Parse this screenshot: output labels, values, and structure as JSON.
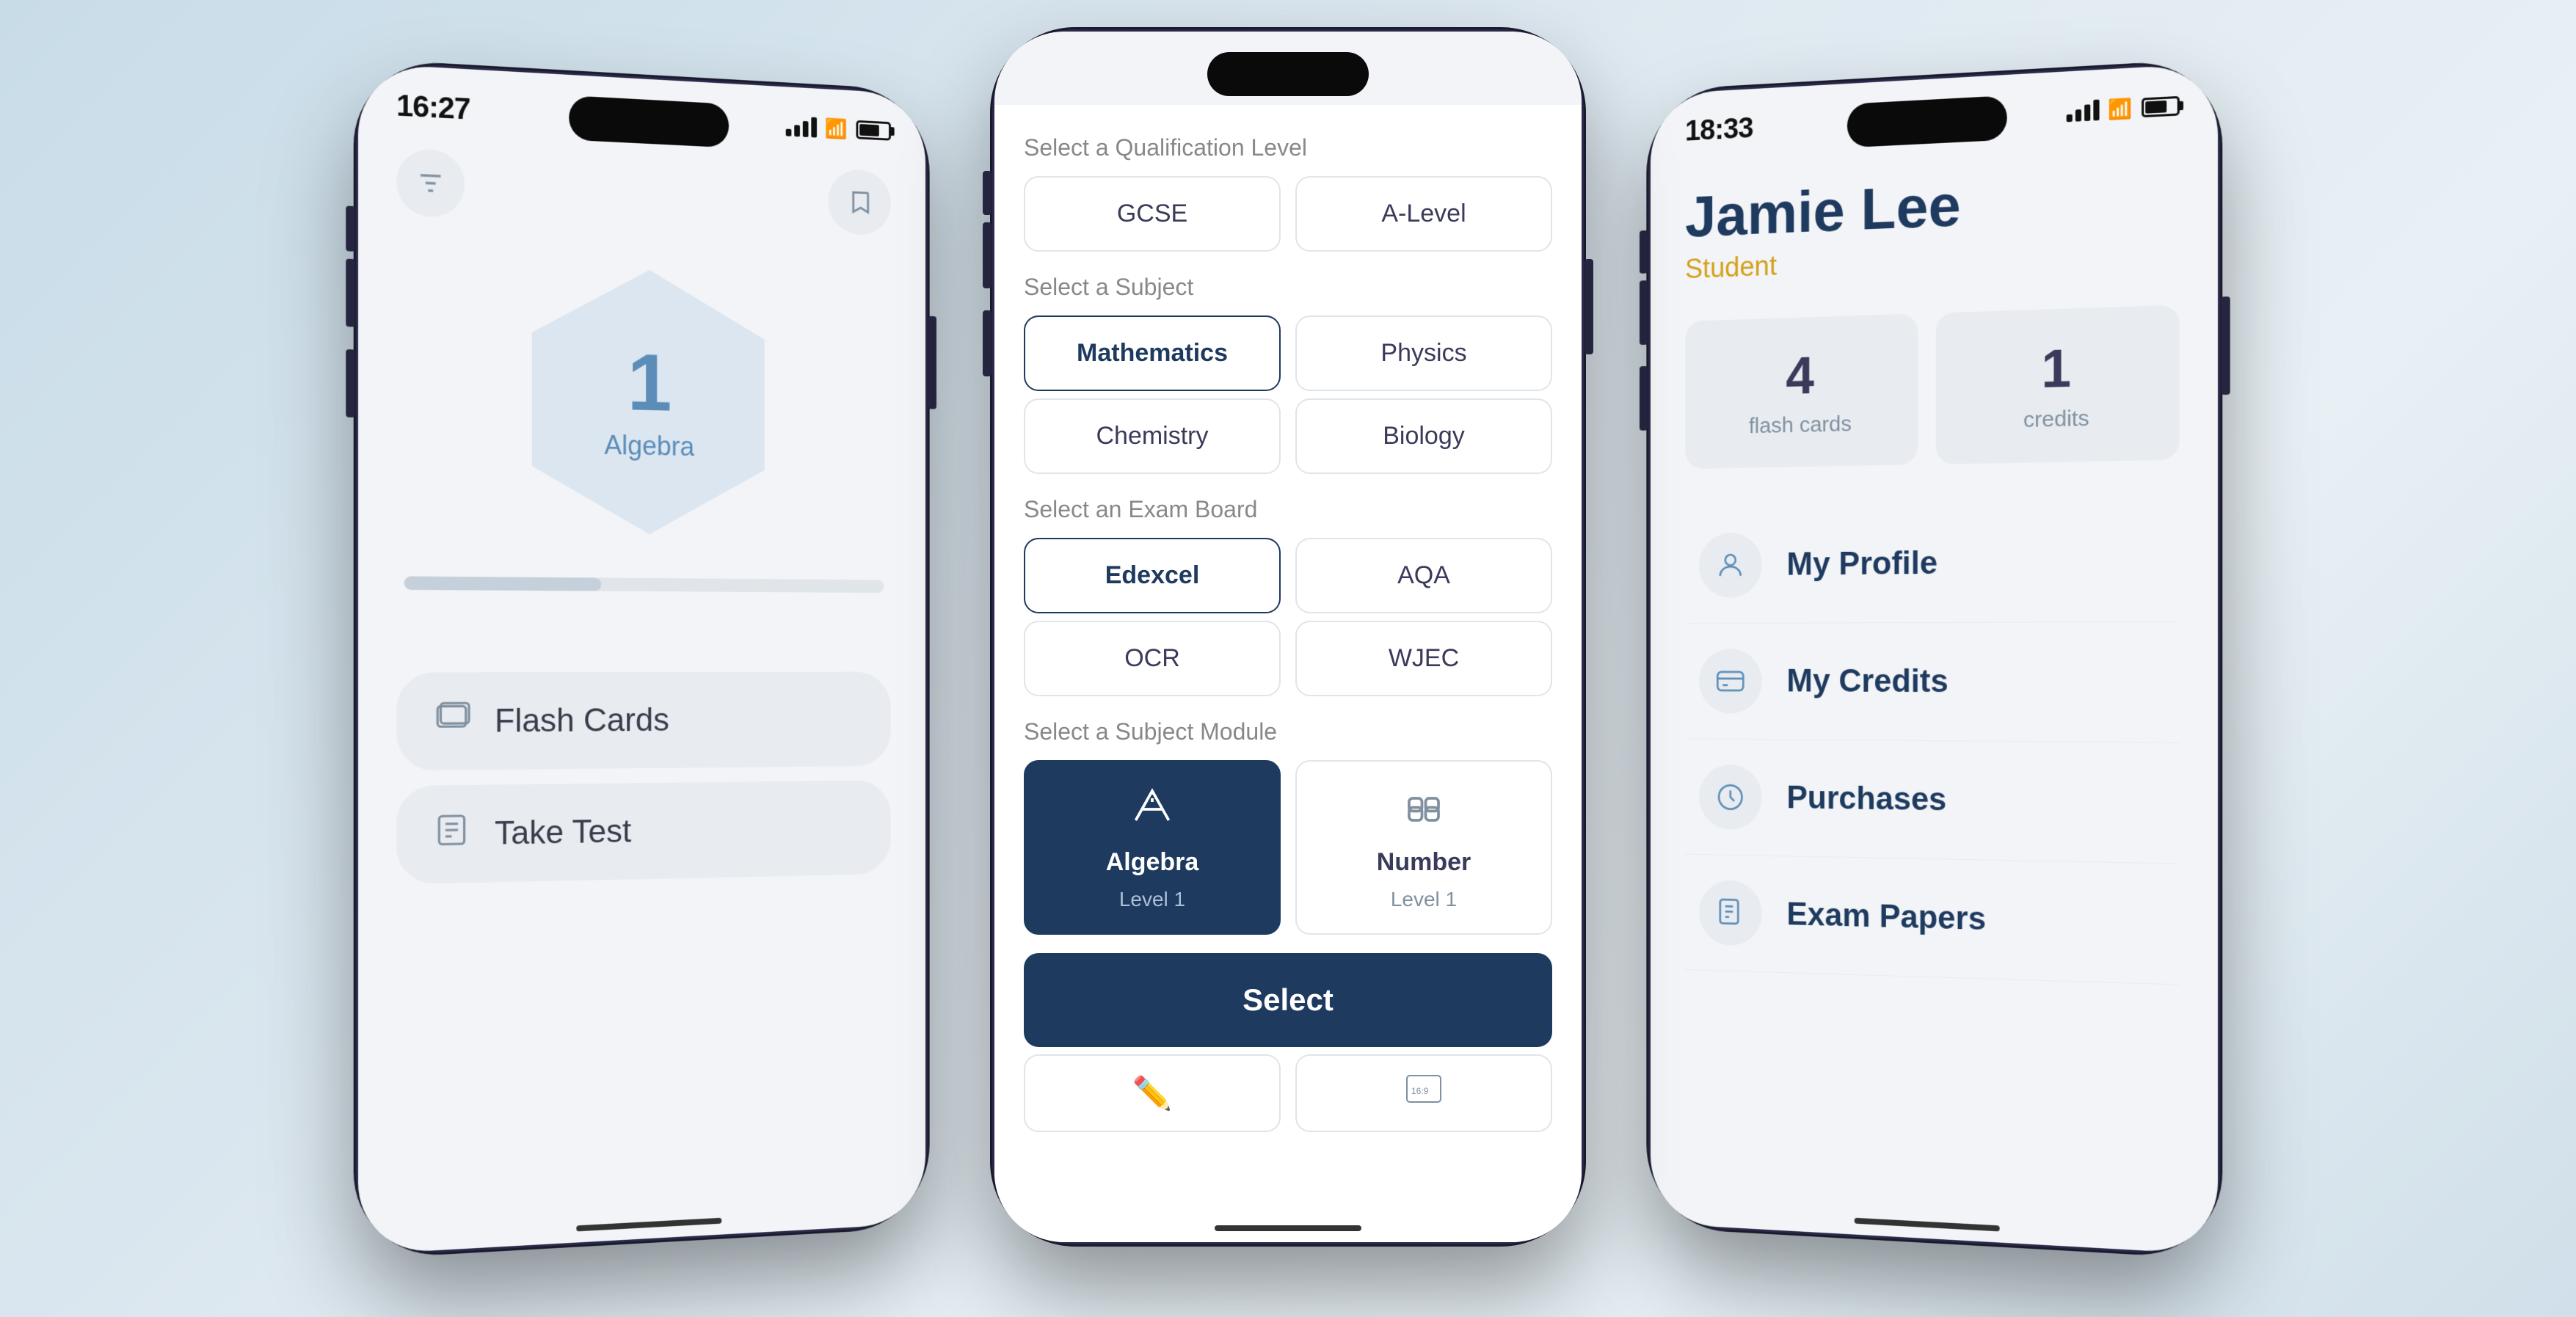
{
  "background": "#c8dce8",
  "phones": {
    "left": {
      "time": "16:27",
      "hex_number": "1",
      "hex_label": "Algebra",
      "flash_cards_label": "Flash Cards",
      "take_test_label": "Take Test"
    },
    "center": {
      "qualification_label": "Select a Qualification Level",
      "gcse_label": "GCSE",
      "alevel_label": "A-Level",
      "subject_label": "Select a Subject",
      "mathematics_label": "Mathematics",
      "physics_label": "Physics",
      "chemistry_label": "Chemistry",
      "biology_label": "Biology",
      "exam_board_label": "Select an Exam Board",
      "edexcel_label": "Edexcel",
      "aqa_label": "AQA",
      "ocr_label": "OCR",
      "wjec_label": "WJEC",
      "module_label": "Select a Subject Module",
      "algebra_title": "Algebra",
      "algebra_sub": "Level 1",
      "number_title": "Number",
      "number_sub": "Level 1",
      "select_btn": "Select"
    },
    "right": {
      "time": "18:33",
      "user_name": "Jamie Lee",
      "user_role": "Student",
      "flash_cards_count": "4",
      "flash_cards_label": "flash cards",
      "credits_count": "1",
      "credits_label": "credits",
      "my_profile_label": "My Profile",
      "my_credits_label": "My Credits",
      "purchases_label": "Purchases",
      "exam_papers_label": "Exam Papers"
    }
  }
}
